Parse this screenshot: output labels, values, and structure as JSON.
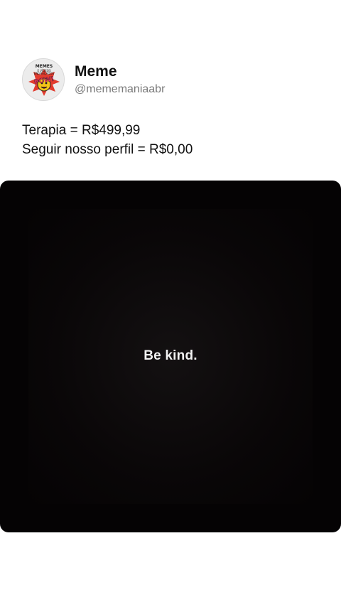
{
  "post": {
    "author": {
      "display_name": "Meme",
      "handle": "@mememaniaabr",
      "avatar_text": {
        "top": "MEMES",
        "middle1": "E VÍDEOS",
        "middle2": "ENGRAÇADOS",
        "bottom": "POW!"
      }
    },
    "text_lines": [
      "Terapia = R$499,99",
      "Seguir nosso perfil = R$0,00"
    ],
    "media": {
      "caption": "Be kind."
    }
  },
  "colors": {
    "background": "#ffffff",
    "media_background": "#050304",
    "handle": "#7a7a7a"
  }
}
